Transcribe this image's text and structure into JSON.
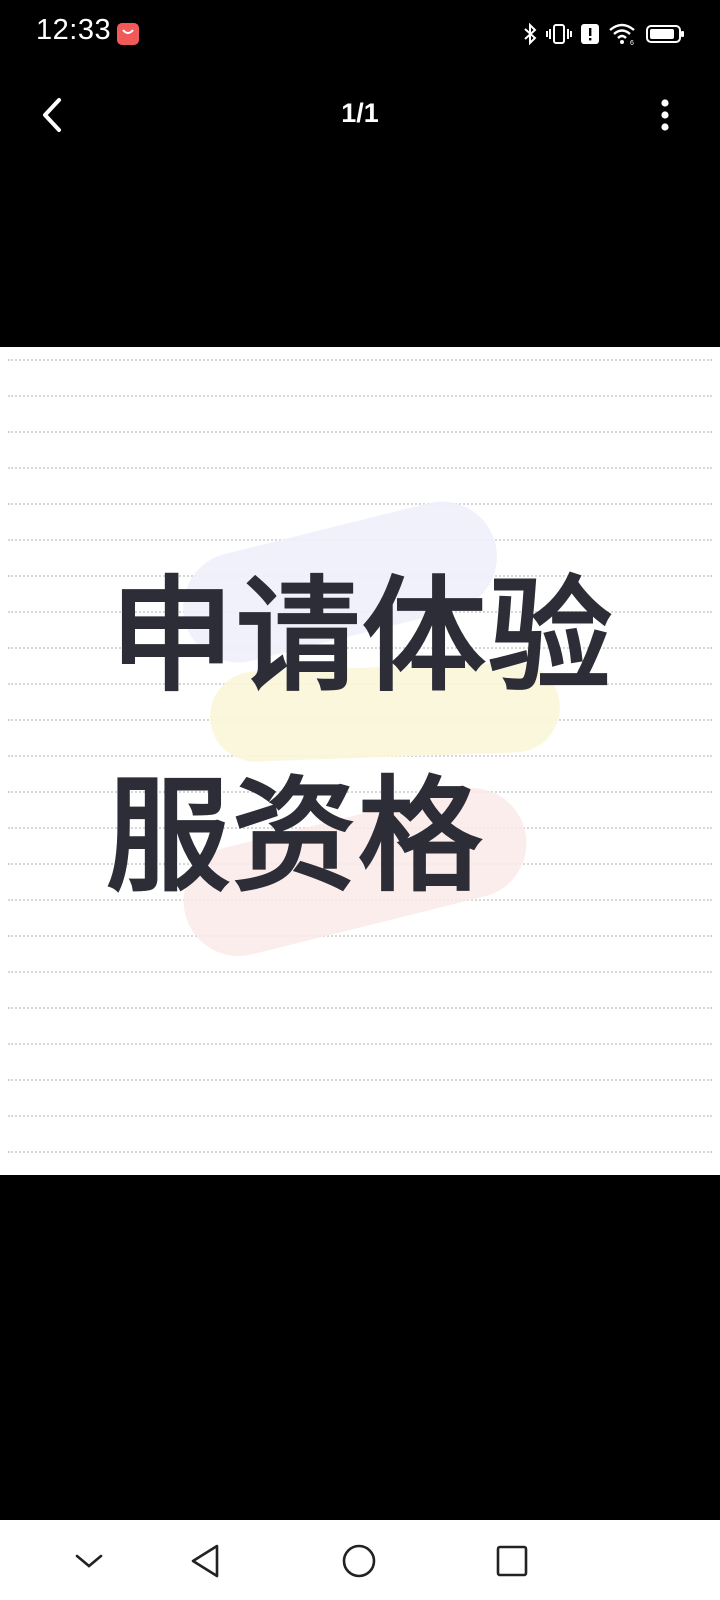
{
  "status_bar": {
    "time": "12:33",
    "icons": [
      "notification-app-icon",
      "bluetooth-icon",
      "vibrate-icon",
      "alert-icon",
      "wifi-icon",
      "battery-icon"
    ],
    "notification_color": "#f25a5a"
  },
  "top_bar": {
    "page_counter": "1/1",
    "back_icon": "chevron-left-icon",
    "more_icon": "more-vertical-icon"
  },
  "image": {
    "headline_line1": "申请体验",
    "headline_line2": "服资格",
    "text_color": "#2c2d36",
    "background": "#ffffff"
  },
  "nav_bar": {
    "buttons": [
      "chevron-down-icon",
      "back-triangle-icon",
      "home-circle-icon",
      "recents-square-icon"
    ]
  }
}
